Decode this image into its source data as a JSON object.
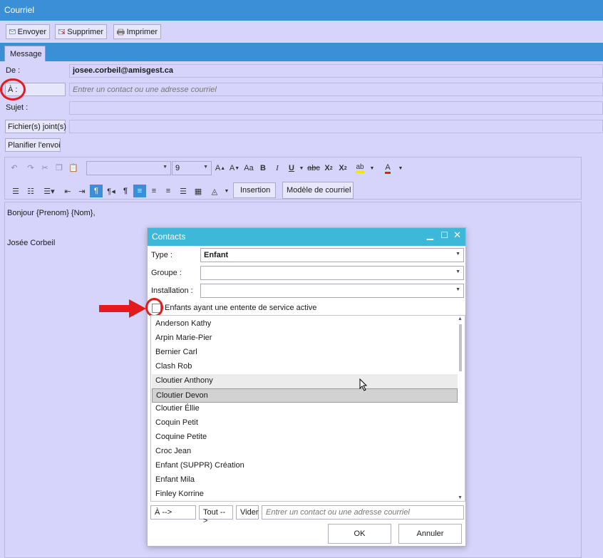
{
  "window": {
    "title": "Courriel"
  },
  "toolbar": {
    "send": "Envoyer",
    "delete": "Supprimer",
    "print": "Imprimer"
  },
  "tabs": {
    "message": "Message"
  },
  "form": {
    "from_label": "De :",
    "from_value": "josee.corbeil@amisgest.ca",
    "to_button": "À :",
    "to_placeholder": "Entrer un contact ou une adresse courriel",
    "subject_label": "Sujet :",
    "attachments_button": "Fichier(s) joint(s)",
    "schedule_button": "Planifier l'envoi"
  },
  "editor_toolbar": {
    "font_size": "9",
    "insert_button": "Insertion",
    "template_button": "Modèle de courriel"
  },
  "editor": {
    "greeting": "Bonjour {Prenom} {Nom},",
    "signature": "Josée Corbeil"
  },
  "dialog": {
    "title": "Contacts",
    "type_label": "Type :",
    "type_value": "Enfant",
    "group_label": "Groupe :",
    "group_value": "",
    "installation_label": "Installation :",
    "installation_value": "",
    "checkbox_label": "Enfants ayant une entente de service active",
    "contacts": [
      "Anderson  Kathy",
      "Arpin  Marie-Pier",
      "Bernier  Carl",
      "Clash  Rob",
      "Cloutier  Anthony",
      "Cloutier  Devon",
      "Cloutier  Éllie",
      "Coquin  Petit",
      "Coquine  Petite",
      "Croc  Jean",
      "Enfant (SUPPR)  Création",
      "Enfant  Mila",
      "Finley  Korrine"
    ],
    "hovered_index": 4,
    "selected_index": 5,
    "to_button": "À -->",
    "all_button": "Tout -->",
    "clear_button": "Vider",
    "recipient_placeholder": "Entrer un contact ou une adresse courriel",
    "ok_button": "OK",
    "cancel_button": "Annuler"
  },
  "colors": {
    "titlebar": "#3a8fd6",
    "dialog_title": "#3db8d8",
    "annotation": "#e21c1c"
  }
}
